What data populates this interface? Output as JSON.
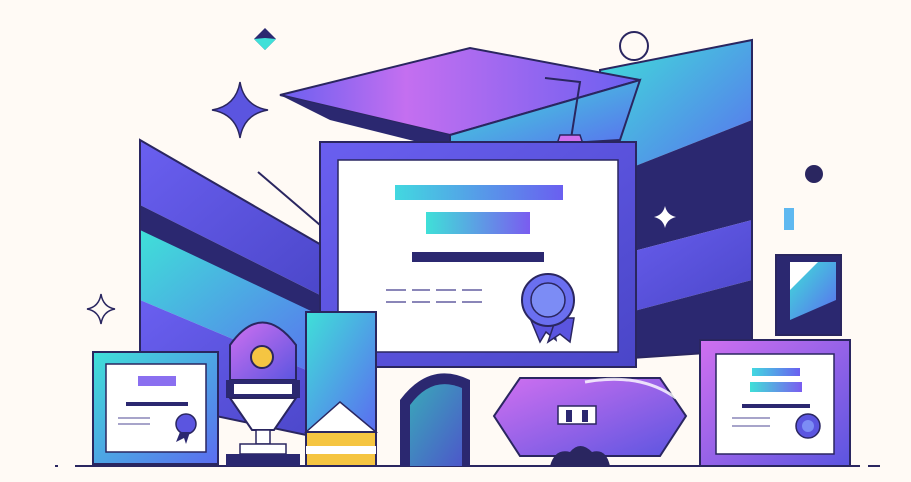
{
  "illustration": {
    "subject": "graduation-certificates-illustration",
    "palette": {
      "background": "#fffaf5",
      "outline": "#2a2660",
      "indigo": "#5b55e0",
      "violet": "#7a5cf0",
      "cyan": "#3fe0d8",
      "magenta": "#d070f0",
      "navy": "#2b2870",
      "paper": "#ffffff",
      "gold": "#f5c542"
    },
    "icons": [
      "graduation-cap-icon",
      "certificate-icon",
      "ribbon-seal-icon",
      "trophy-icon",
      "sparkle-icon",
      "books-icon"
    ]
  }
}
